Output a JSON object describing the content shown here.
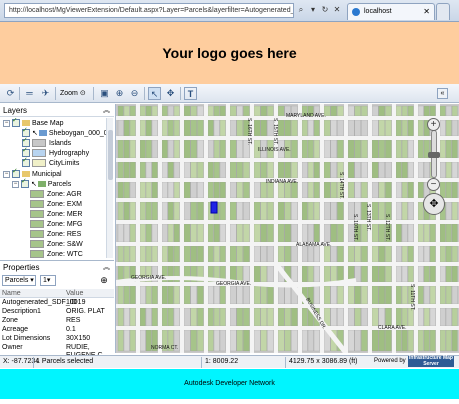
{
  "browser": {
    "address": "http://localhost/MgViewerExtension/Default.aspx?Layer=Parcels&layerfilter=Autogenerated_SDF_ID > 10000",
    "tab_title": "localhost"
  },
  "header": {
    "logo_text": "Your logo goes here"
  },
  "toolbar": {
    "zoom_label": "Zoom"
  },
  "layers": {
    "title": "Layers",
    "items": [
      {
        "label": "Base Map"
      },
      {
        "label": "Sheboygan_000_0"
      },
      {
        "label": "Islands",
        "color": "#c8c8c8"
      },
      {
        "label": "Hydrography",
        "color": "#b8d4f0"
      },
      {
        "label": "CityLimits",
        "color": "#f0f0c8"
      },
      {
        "label": "Municipal"
      },
      {
        "label": "Parcels"
      },
      {
        "label": "Zone: AGR",
        "color": "#a6c48a"
      },
      {
        "label": "Zone: EXM",
        "color": "#a6c48a"
      },
      {
        "label": "Zone: MER",
        "color": "#a6c48a"
      },
      {
        "label": "Zone: MFG",
        "color": "#a6c48a"
      },
      {
        "label": "Zone: RES",
        "color": "#a6c48a"
      },
      {
        "label": "Zone: S&W",
        "color": "#a6c48a"
      },
      {
        "label": "Zone: WTC",
        "color": "#a6c48a"
      }
    ]
  },
  "properties": {
    "title": "Properties",
    "layer_select": "Parcels",
    "index_select": "1",
    "col_name": "Name",
    "col_value": "Value",
    "rows": [
      {
        "name": "Autogenerated_SDF_ID",
        "value": "10019"
      },
      {
        "name": "Description1",
        "value": "ORIG. PLAT"
      },
      {
        "name": "Zone",
        "value": "RES"
      },
      {
        "name": "Acreage",
        "value": "0.1"
      },
      {
        "name": "Lot Dimensions",
        "value": "30X150"
      },
      {
        "name": "Owner",
        "value": "RUDIE, EUGENE C."
      }
    ]
  },
  "map": {
    "streets": [
      "MARYLAND AVE.",
      "ILLINOIS AVE.",
      "INDIANA AVE.",
      "ALABAMA AVE.",
      "GEORGIA AVE.",
      "GEORGIA AVE.",
      "CLARA AVE.",
      "NORMA CT.",
      "S. 16TH ST.",
      "S. 15TH ST.",
      "S. 14TH ST.",
      "S. 13TH ST.",
      "S. 12TH ST.",
      "S. 11TH ST.",
      "BUSINESS DR.",
      "S. 10TH ST."
    ]
  },
  "status": {
    "coords": "X: -87.7234",
    "selected": "1 Parcels selected",
    "scale": "1: 8009.22",
    "extent": "4129.75 x 3086.89 (ft)",
    "powered": "Powered by",
    "badge": "Infrastructure Map Server"
  },
  "footer": {
    "text": "Autodesk Developer Network"
  }
}
